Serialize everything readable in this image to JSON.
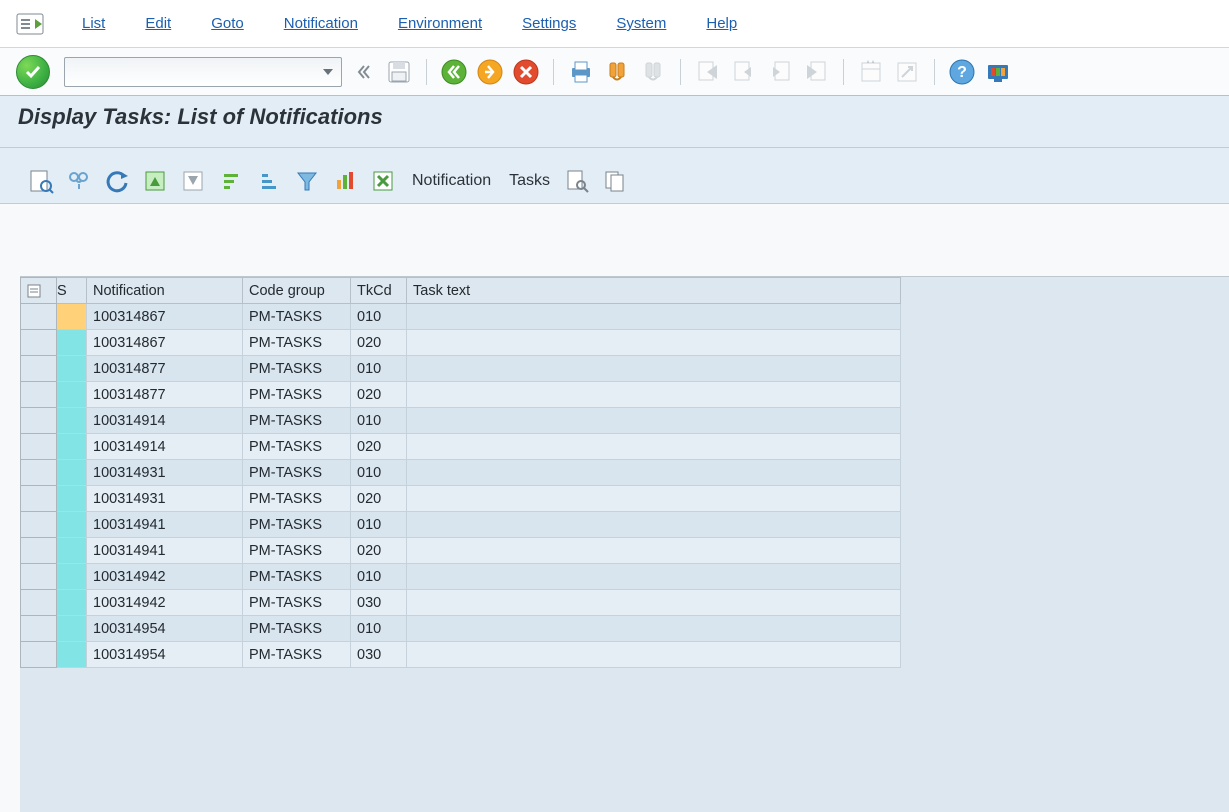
{
  "menu": {
    "items": [
      "List",
      "Edit",
      "Goto",
      "Notification",
      "Environment",
      "Settings",
      "System",
      "Help"
    ]
  },
  "system_toolbar": {
    "command_value": "",
    "tooltips": {
      "ok": "Enter",
      "back": "Back",
      "exit": "Exit",
      "cancel": "Cancel",
      "save": "Save",
      "print": "Print",
      "find": "Find",
      "find_next": "Find next",
      "first": "First page",
      "prev": "Previous page",
      "next": "Next page",
      "last": "Last page",
      "new": "New session",
      "generate": "Generate shortcut",
      "help": "Help",
      "layout": "Customize local layout"
    }
  },
  "page": {
    "title": "Display Tasks: List of Notifications"
  },
  "app_toolbar": {
    "labels": {
      "notification": "Notification",
      "tasks": "Tasks"
    }
  },
  "grid": {
    "headers": {
      "status": "S",
      "notification": "Notification",
      "code_group": "Code group",
      "tkcd": "TkCd",
      "task_text": "Task text"
    },
    "rows": [
      {
        "status": "amber",
        "notification": "100314867",
        "code_group": "PM-TASKS",
        "tkcd": "010",
        "task_text": ""
      },
      {
        "status": "cyan",
        "notification": "100314867",
        "code_group": "PM-TASKS",
        "tkcd": "020",
        "task_text": ""
      },
      {
        "status": "cyan",
        "notification": "100314877",
        "code_group": "PM-TASKS",
        "tkcd": "010",
        "task_text": ""
      },
      {
        "status": "cyan",
        "notification": "100314877",
        "code_group": "PM-TASKS",
        "tkcd": "020",
        "task_text": ""
      },
      {
        "status": "cyan",
        "notification": "100314914",
        "code_group": "PM-TASKS",
        "tkcd": "010",
        "task_text": ""
      },
      {
        "status": "cyan",
        "notification": "100314914",
        "code_group": "PM-TASKS",
        "tkcd": "020",
        "task_text": ""
      },
      {
        "status": "cyan",
        "notification": "100314931",
        "code_group": "PM-TASKS",
        "tkcd": "010",
        "task_text": ""
      },
      {
        "status": "cyan",
        "notification": "100314931",
        "code_group": "PM-TASKS",
        "tkcd": "020",
        "task_text": ""
      },
      {
        "status": "cyan",
        "notification": "100314941",
        "code_group": "PM-TASKS",
        "tkcd": "010",
        "task_text": ""
      },
      {
        "status": "cyan",
        "notification": "100314941",
        "code_group": "PM-TASKS",
        "tkcd": "020",
        "task_text": ""
      },
      {
        "status": "cyan",
        "notification": "100314942",
        "code_group": "PM-TASKS",
        "tkcd": "010",
        "task_text": ""
      },
      {
        "status": "cyan",
        "notification": "100314942",
        "code_group": "PM-TASKS",
        "tkcd": "030",
        "task_text": ""
      },
      {
        "status": "cyan",
        "notification": "100314954",
        "code_group": "PM-TASKS",
        "tkcd": "010",
        "task_text": ""
      },
      {
        "status": "cyan",
        "notification": "100314954",
        "code_group": "PM-TASKS",
        "tkcd": "030",
        "task_text": ""
      }
    ]
  }
}
